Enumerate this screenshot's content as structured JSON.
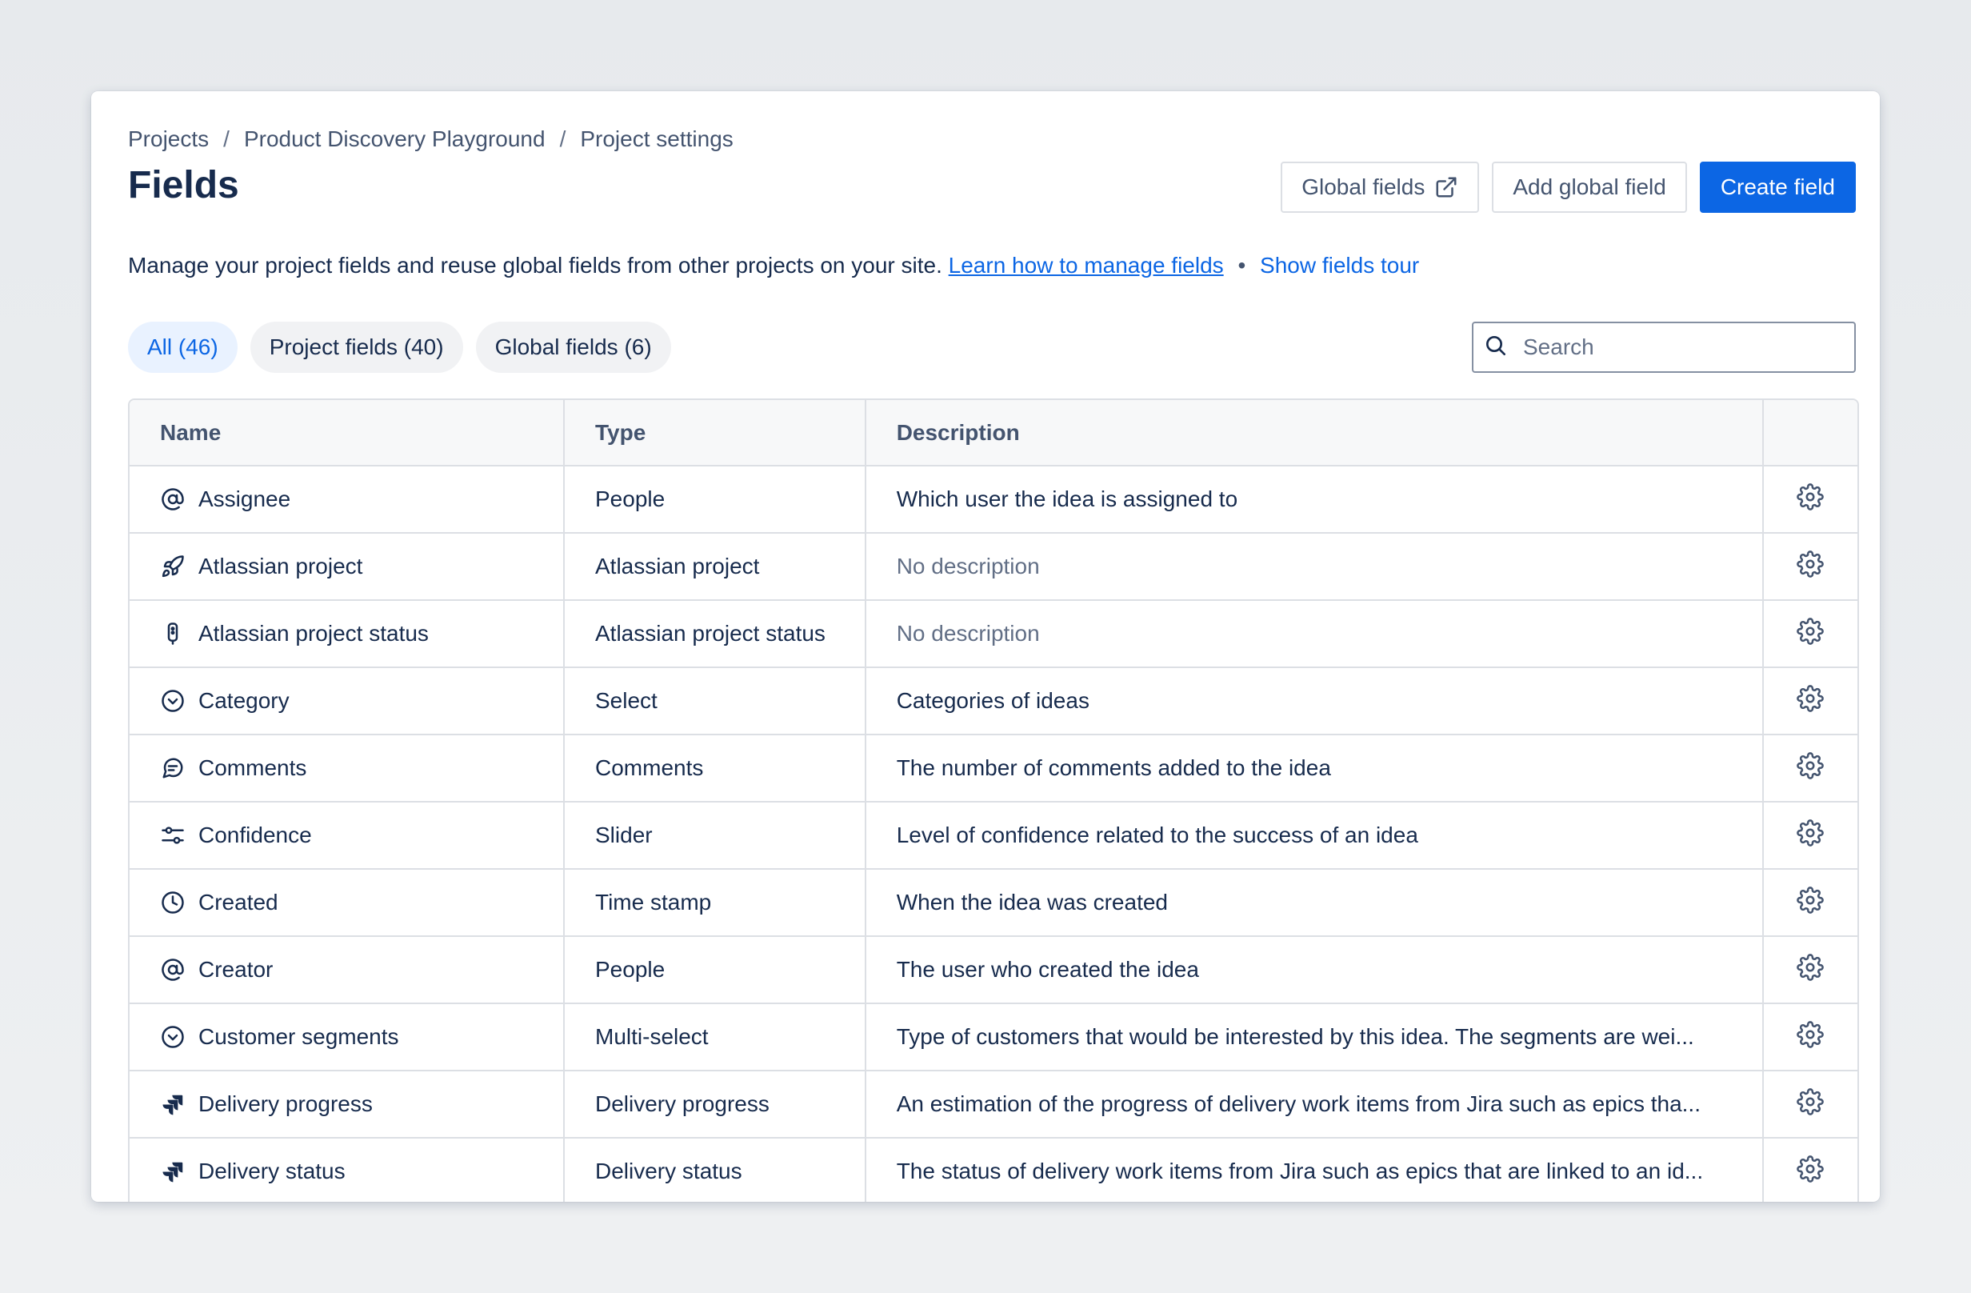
{
  "breadcrumb": {
    "items": [
      "Projects",
      "Product Discovery Playground",
      "Project settings"
    ],
    "separator": "/"
  },
  "page": {
    "title": "Fields",
    "description": "Manage your project fields and reuse global fields from other projects on your site.",
    "learn_link": "Learn how to manage fields",
    "bullet": "•",
    "tour_link": "Show fields tour"
  },
  "actions": {
    "global_fields": "Global fields",
    "add_global_field": "Add global field",
    "create_field": "Create field"
  },
  "filters": [
    {
      "label": "All (46)",
      "selected": true
    },
    {
      "label": "Project fields (40)",
      "selected": false
    },
    {
      "label": "Global fields (6)",
      "selected": false
    }
  ],
  "search": {
    "placeholder": "Search",
    "value": ""
  },
  "table": {
    "headers": [
      "Name",
      "Type",
      "Description",
      ""
    ],
    "rows": [
      {
        "icon": "at-sign-icon",
        "name": "Assignee",
        "type": "People",
        "description": "Which user the idea is assigned to",
        "muted": false
      },
      {
        "icon": "rocket-icon",
        "name": "Atlassian project",
        "type": "Atlassian project",
        "description": "No description",
        "muted": true
      },
      {
        "icon": "traffic-light-icon",
        "name": "Atlassian project status",
        "type": "Atlassian project status",
        "description": "No description",
        "muted": true
      },
      {
        "icon": "chevron-circle-icon",
        "name": "Category",
        "type": "Select",
        "description": "Categories of ideas",
        "muted": false
      },
      {
        "icon": "comment-icon",
        "name": "Comments",
        "type": "Comments",
        "description": "The number of comments added to the idea",
        "muted": false
      },
      {
        "icon": "slider-icon",
        "name": "Confidence",
        "type": "Slider",
        "description": "Level of confidence related to the success of an idea",
        "muted": false
      },
      {
        "icon": "clock-icon",
        "name": "Created",
        "type": "Time stamp",
        "description": "When the idea was created",
        "muted": false
      },
      {
        "icon": "at-sign-icon",
        "name": "Creator",
        "type": "People",
        "description": "The user who created the idea",
        "muted": false
      },
      {
        "icon": "chevron-circle-icon",
        "name": "Customer segments",
        "type": "Multi-select",
        "description": "Type of customers that would be interested by this idea. The segments are wei...",
        "muted": false
      },
      {
        "icon": "jira-icon",
        "name": "Delivery progress",
        "type": "Delivery progress",
        "description": "An estimation of the progress of delivery work items from Jira such as epics tha...",
        "muted": false
      },
      {
        "icon": "jira-icon",
        "name": "Delivery status",
        "type": "Delivery status",
        "description": "The status of delivery work items from Jira such as epics that are linked to an id...",
        "muted": false
      }
    ]
  },
  "colors": {
    "primary": "#0c66e4",
    "text": "#172b4d",
    "subtle_text": "#44546f",
    "muted_text": "#626f86",
    "border": "#dcdfe4",
    "selected_chip_bg": "#e9f2ff"
  }
}
